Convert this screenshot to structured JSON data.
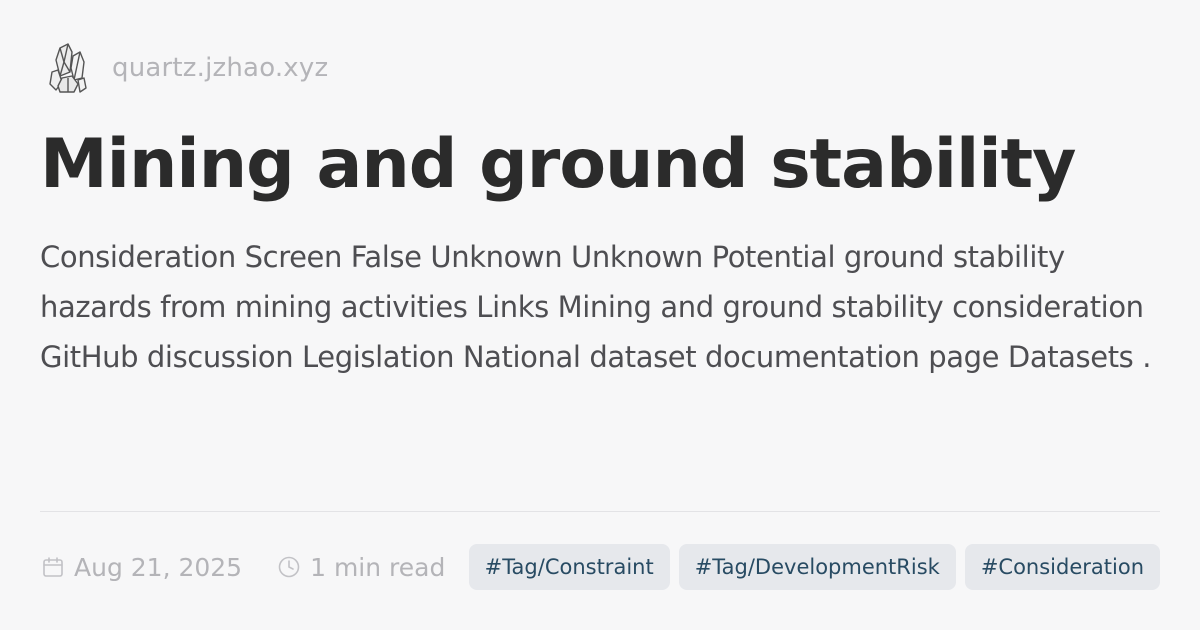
{
  "site": {
    "logo_icon": "crystal-icon",
    "name": "quartz.jzhao.xyz"
  },
  "page": {
    "title": "Mining and ground stability",
    "description": "Consideration Screen False Unknown Unknown Potential ground stability hazards from mining activities Links Mining and ground stability consideration GitHub discussion Legislation National dataset documentation page Datasets ."
  },
  "meta": {
    "date_icon": "calendar-icon",
    "date": "Aug 21, 2025",
    "read_icon": "clock-icon",
    "read_time": "1 min read"
  },
  "tags": [
    {
      "label": "#Tag/Constraint"
    },
    {
      "label": "#Tag/DevelopmentRisk"
    },
    {
      "label": "#Consideration"
    }
  ],
  "colors": {
    "background": "#f7f7f8",
    "title": "#2b2b2b",
    "muted": "#b4b4b8",
    "tag_background": "#e6e8ec",
    "tag_text": "#284b63"
  }
}
